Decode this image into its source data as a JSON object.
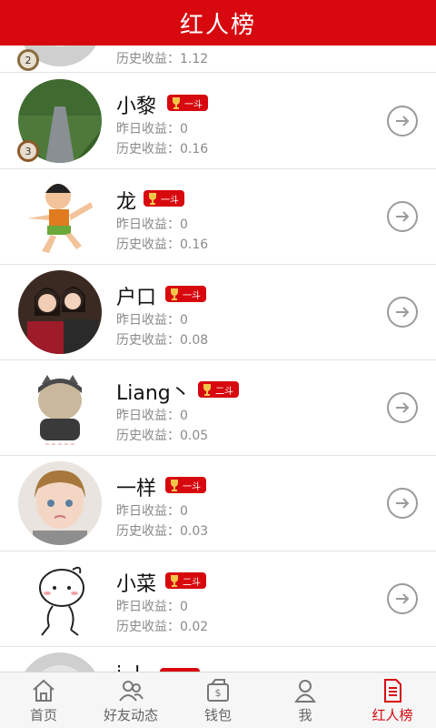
{
  "header": {
    "title": "红人榜"
  },
  "stats_labels": {
    "yesterday": "昨日收益：",
    "history": "历史收益："
  },
  "rows": [
    {
      "name": "",
      "level": "",
      "yesterday": "",
      "history": "1.12",
      "rank": "2"
    },
    {
      "name": "小黎",
      "level": "一斗",
      "yesterday": "0",
      "history": "0.16",
      "rank": "3"
    },
    {
      "name": "龙",
      "level": "一斗",
      "yesterday": "0",
      "history": "0.16"
    },
    {
      "name": "户口",
      "level": "一斗",
      "yesterday": "0",
      "history": "0.08"
    },
    {
      "name": "Liang丶",
      "level": "二斗",
      "yesterday": "0",
      "history": "0.05"
    },
    {
      "name": "一样",
      "level": "一斗",
      "yesterday": "0",
      "history": "0.03"
    },
    {
      "name": "小菜",
      "level": "二斗",
      "yesterday": "0",
      "history": "0.02"
    },
    {
      "name": "i..l",
      "level": "",
      "yesterday": "",
      "history": ""
    }
  ],
  "tabbar": {
    "items": [
      {
        "label": "首页",
        "icon": "home-icon"
      },
      {
        "label": "好友动态",
        "icon": "friends-icon"
      },
      {
        "label": "钱包",
        "icon": "wallet-icon"
      },
      {
        "label": "我",
        "icon": "profile-icon"
      },
      {
        "label": "红人榜",
        "icon": "document-icon",
        "active": true
      }
    ]
  },
  "colors": {
    "brand_red": "#d7090f",
    "muted_text": "#8a8a8a"
  }
}
